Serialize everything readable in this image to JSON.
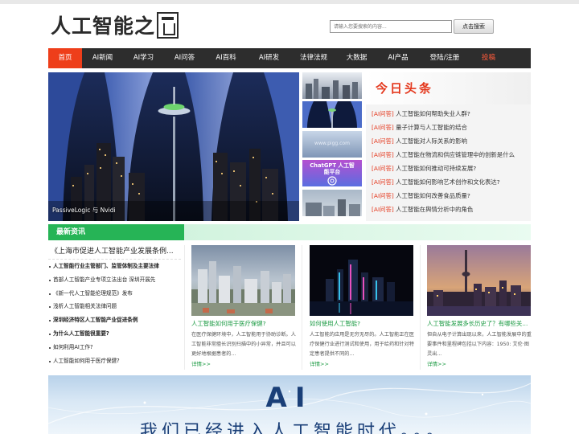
{
  "site": {
    "logo_text": "人工智能之",
    "search_placeholder": "请输入您要搜索的内容...",
    "search_button": "点击搜索"
  },
  "nav": [
    {
      "label": "首页",
      "state": "active"
    },
    {
      "label": "AI新闻",
      "state": ""
    },
    {
      "label": "AI学习",
      "state": ""
    },
    {
      "label": "AI问答",
      "state": ""
    },
    {
      "label": "AI百科",
      "state": ""
    },
    {
      "label": "AI研发",
      "state": ""
    },
    {
      "label": "法律法规",
      "state": ""
    },
    {
      "label": "大数据",
      "state": ""
    },
    {
      "label": "AI产品",
      "state": ""
    },
    {
      "label": "登陆/注册",
      "state": ""
    },
    {
      "label": "投稿",
      "state": "highlight"
    }
  ],
  "hero": {
    "caption": "PassiveLogic 与 Nvidi"
  },
  "thumbs": [
    {
      "text": ""
    },
    {
      "text": ""
    },
    {
      "text": "www.pigg.com"
    },
    {
      "text": "ChatGPT 人工智能平台"
    },
    {
      "text": ""
    }
  ],
  "headlines": {
    "title": "今日头条",
    "tag": "[AI问答]",
    "items": [
      "人工智能如何帮助失业人群?",
      "量子计算与人工智能的结合",
      "人工智能对人际关系的影响",
      "人工智能在物流和供应链管理中的创新是什么",
      "人工智能如何推动可持续发展?",
      "人工智能如何影响艺术创作和文化表达?",
      "人工智能如何改善食品质量?",
      "人工智能在舆情分析中的角色"
    ]
  },
  "latest": {
    "tab_label": "最新资讯",
    "head": "《上海市促进人工智能产业发展条例...",
    "items": [
      {
        "text": "人工智能行业主管部门、监管体制及主要法律",
        "bold": true
      },
      {
        "text": "首部人工智能产业专项立法出台 深圳开展先",
        "bold": false
      },
      {
        "text": "《新一代人工智能伦理规范》发布",
        "bold": false
      },
      {
        "text": "浅析人工智能相关法律问题",
        "bold": false
      },
      {
        "text": "深圳经济特区人工智能产业促进条例",
        "bold": true
      },
      {
        "text": "为什么人工智能很重要?",
        "bold": true
      },
      {
        "text": "如何利用AI工作?",
        "bold": false
      },
      {
        "text": "人工智能如何用于医疗保健?",
        "bold": false
      }
    ]
  },
  "cards": [
    {
      "title": "人工智能如何用于医疗保健?",
      "desc": "在医疗保健环境中，人工智能用于协助诊断。人工智能非常擅长识别扫描中的小异常，并且可以更好地根据患者的...",
      "more": "详情>>"
    },
    {
      "title": "如何使用人工智能?",
      "desc": "人工智能的应用是无穷无尽的。人工智能正在医疗保健行业进行测试和使用，用于给药和针对特定患者提供不同的...",
      "more": "详情>>"
    },
    {
      "title": "人工智能发展多长历史了？有哪些关...",
      "desc": "但自从电子计算出现以来，人工智能发展中的重要事件和里程碑包括以下内容：1950: 艾伦·图灵出...",
      "more": "详情>>"
    }
  ],
  "banner": {
    "title": "AI",
    "subtitle": "我们已经进入人工智能时代。。。"
  },
  "colors": {
    "accent_red": "#ee3e1a",
    "nav_bg": "#2d2d2d",
    "green": "#26b456",
    "link_green": "#1a9a42",
    "banner_blue": "#1a3f78"
  }
}
